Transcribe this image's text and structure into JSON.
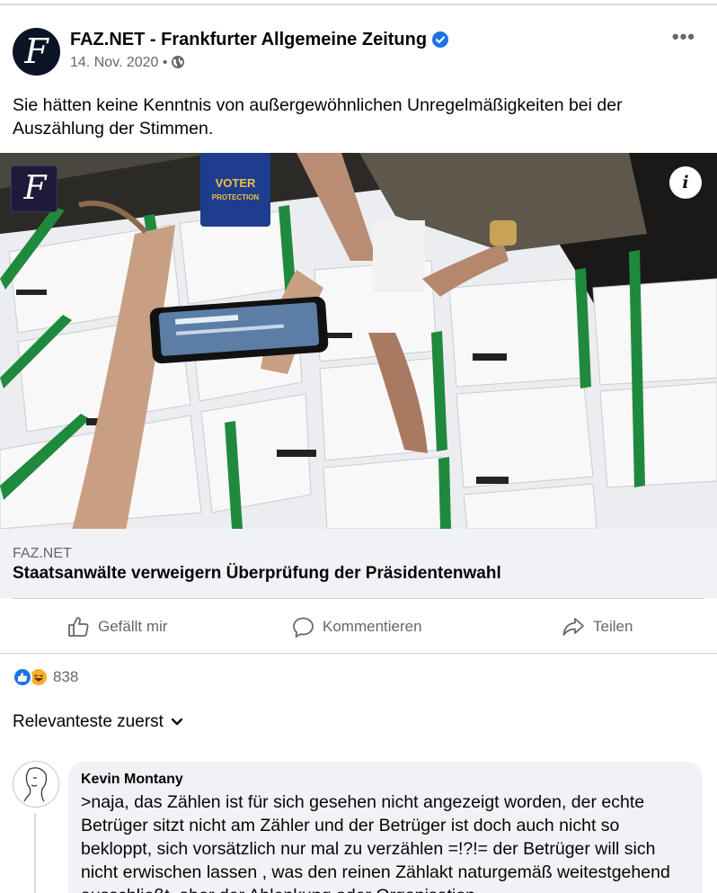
{
  "post": {
    "page_name": "FAZ.NET - Frankfurter Allgemeine Zeitung",
    "date": "14. Nov. 2020",
    "separator": "•",
    "privacy_icon": "globe-icon",
    "avatar_letter": "F",
    "text": "Sie hätten keine Kenntnis von außergewöhnlichen Unregelmäßigkeiten bei der Auszählung der Stimmen."
  },
  "image": {
    "logo_letter": "F",
    "sticker_line1": "VOTER",
    "sticker_line2": "PROTECTION",
    "info_label": "i"
  },
  "link": {
    "domain": "FAZ.NET",
    "title": "Staatsanwälte verweigern Überprüfung der Präsidentenwahl"
  },
  "actions": {
    "like": "Gefällt mir",
    "comment": "Kommentieren",
    "share": "Teilen"
  },
  "reactions": {
    "count": "838",
    "types": [
      "like",
      "haha"
    ]
  },
  "comments": {
    "sort_label": "Relevanteste zuerst",
    "items": [
      {
        "author": "Kevin Montany",
        "text": ">naja, das Zählen ist für sich gesehen nicht angezeigt worden, der echte Betrüger sitzt nicht am Zähler und der Betrüger  ist doch auch nicht so bekloppt, sich vorsätzlich nur mal zu verzählen =!?!= der Betrüger will sich nicht erwischen lassen , was den reinen Zählakt naturgemäß weitestgehend ausschließt, aber der Ablenkung oder Organisation"
      }
    ]
  },
  "colors": {
    "brand_blue": "#1b74e4",
    "secondary_text": "#65676b",
    "bubble_bg": "#f0f2f5",
    "ballot_green": "#1f8a3c"
  }
}
